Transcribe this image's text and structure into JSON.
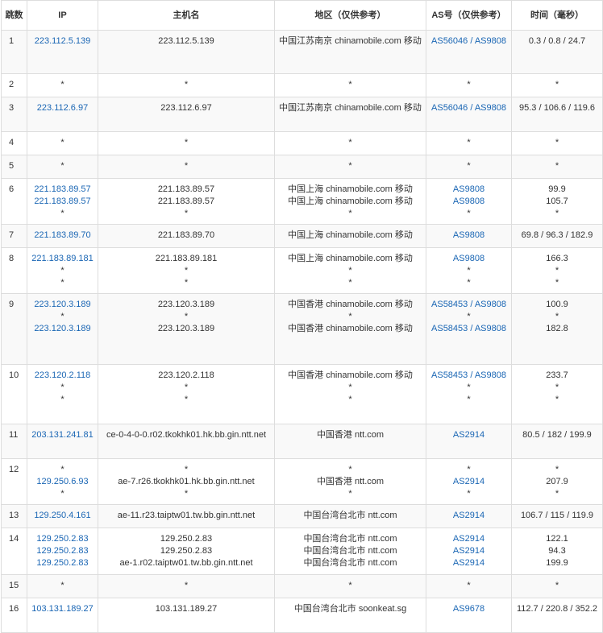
{
  "colors": {
    "link": "#1a66b4",
    "border": "#dddddd",
    "stripe": "#f9f9f9",
    "text": "#333333"
  },
  "headers": {
    "hop": "跳数",
    "ip": "IP",
    "host": "主机名",
    "region": "地区（仅供参考）",
    "as": "AS号（仅供参考）",
    "time": "时间（毫秒）"
  },
  "rows": [
    {
      "hop": "1",
      "ip": [
        "223.112.5.139"
      ],
      "host": [
        "223.112.5.139"
      ],
      "region": [
        "中国江苏南京 chinamobile.com 移动"
      ],
      "as": [
        "AS56046 / AS9808"
      ],
      "time": [
        "0.3 / 0.8 / 24.7"
      ]
    },
    {
      "hop": "2",
      "ip": [
        "*"
      ],
      "host": [
        "*"
      ],
      "region": [
        "*"
      ],
      "as": [
        "*"
      ],
      "time": [
        "*"
      ]
    },
    {
      "hop": "3",
      "ip": [
        "223.112.6.97"
      ],
      "host": [
        "223.112.6.97"
      ],
      "region": [
        "中国江苏南京 chinamobile.com 移动"
      ],
      "as": [
        "AS56046 / AS9808"
      ],
      "time": [
        "95.3 / 106.6 / 119.6"
      ]
    },
    {
      "hop": "4",
      "ip": [
        "*"
      ],
      "host": [
        "*"
      ],
      "region": [
        "*"
      ],
      "as": [
        "*"
      ],
      "time": [
        "*"
      ]
    },
    {
      "hop": "5",
      "ip": [
        "*"
      ],
      "host": [
        "*"
      ],
      "region": [
        "*"
      ],
      "as": [
        "*"
      ],
      "time": [
        "*"
      ]
    },
    {
      "hop": "6",
      "ip": [
        "221.183.89.57",
        "221.183.89.57",
        "*"
      ],
      "host": [
        "221.183.89.57",
        "221.183.89.57",
        "*"
      ],
      "region": [
        "中国上海 chinamobile.com 移动",
        "中国上海 chinamobile.com 移动",
        "*"
      ],
      "as": [
        "AS9808",
        "AS9808",
        "*"
      ],
      "time": [
        "99.9",
        "105.7",
        "*"
      ]
    },
    {
      "hop": "7",
      "ip": [
        "221.183.89.70"
      ],
      "host": [
        "221.183.89.70"
      ],
      "region": [
        "中国上海 chinamobile.com 移动"
      ],
      "as": [
        "AS9808"
      ],
      "time": [
        "69.8 / 96.3 / 182.9"
      ]
    },
    {
      "hop": "8",
      "ip": [
        "221.183.89.181",
        "*",
        "*"
      ],
      "host": [
        "221.183.89.181",
        "*",
        "*"
      ],
      "region": [
        "中国上海 chinamobile.com 移动",
        "*",
        "*"
      ],
      "as": [
        "AS9808",
        "*",
        "*"
      ],
      "time": [
        "166.3",
        "*",
        "*"
      ]
    },
    {
      "hop": "9",
      "ip": [
        "223.120.3.189",
        "*",
        "223.120.3.189"
      ],
      "host": [
        "223.120.3.189",
        "*",
        "223.120.3.189"
      ],
      "region": [
        "中国香港 chinamobile.com 移动",
        "*",
        "中国香港 chinamobile.com 移动"
      ],
      "as": [
        "AS58453 / AS9808",
        "*",
        "AS58453 / AS9808"
      ],
      "time": [
        "100.9",
        "*",
        "182.8"
      ]
    },
    {
      "hop": "10",
      "ip": [
        "223.120.2.118",
        "*",
        "*"
      ],
      "host": [
        "223.120.2.118",
        "*",
        "*"
      ],
      "region": [
        "中国香港 chinamobile.com 移动",
        "*",
        "*"
      ],
      "as": [
        "AS58453 / AS9808",
        "*",
        "*"
      ],
      "time": [
        "233.7",
        "*",
        "*"
      ]
    },
    {
      "hop": "11",
      "ip": [
        "203.131.241.81"
      ],
      "host": [
        "ce-0-4-0-0.r02.tkokhk01.hk.bb.gin.ntt.net"
      ],
      "region": [
        "中国香港 ntt.com"
      ],
      "as": [
        "AS2914"
      ],
      "time": [
        "80.5 / 182 / 199.9"
      ]
    },
    {
      "hop": "12",
      "ip": [
        "*",
        "129.250.6.93",
        "*"
      ],
      "host": [
        "*",
        "ae-7.r26.tkokhk01.hk.bb.gin.ntt.net",
        "*"
      ],
      "region": [
        "*",
        "中国香港 ntt.com",
        "*"
      ],
      "as": [
        "*",
        "AS2914",
        "*"
      ],
      "time": [
        "*",
        "207.9",
        "*"
      ]
    },
    {
      "hop": "13",
      "ip": [
        "129.250.4.161"
      ],
      "host": [
        "ae-11.r23.taiptw01.tw.bb.gin.ntt.net"
      ],
      "region": [
        "中国台湾台北市 ntt.com"
      ],
      "as": [
        "AS2914"
      ],
      "time": [
        "106.7 / 115 / 119.9"
      ]
    },
    {
      "hop": "14",
      "ip": [
        "129.250.2.83",
        "129.250.2.83",
        "129.250.2.83"
      ],
      "host": [
        "129.250.2.83",
        "129.250.2.83",
        "ae-1.r02.taiptw01.tw.bb.gin.ntt.net"
      ],
      "region": [
        "中国台湾台北市 ntt.com",
        "中国台湾台北市 ntt.com",
        "中国台湾台北市 ntt.com"
      ],
      "as": [
        "AS2914",
        "AS2914",
        "AS2914"
      ],
      "time": [
        "122.1",
        "94.3",
        "199.9"
      ]
    },
    {
      "hop": "15",
      "ip": [
        "*"
      ],
      "host": [
        "*"
      ],
      "region": [
        "*"
      ],
      "as": [
        "*"
      ],
      "time": [
        "*"
      ]
    },
    {
      "hop": "16",
      "ip": [
        "103.131.189.27"
      ],
      "host": [
        "103.131.189.27"
      ],
      "region": [
        "中国台湾台北市 soonkeat.sg"
      ],
      "as": [
        "AS9678"
      ],
      "time": [
        "112.7 / 220.8 / 352.2"
      ]
    }
  ]
}
